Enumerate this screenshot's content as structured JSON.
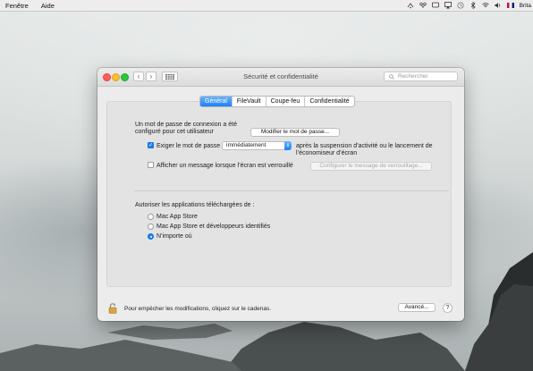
{
  "menubar": {
    "items": [
      "Fenêtre",
      "Aide"
    ],
    "user": "Brita"
  },
  "window": {
    "title": "Sécurité et confidentialité",
    "search_placeholder": "Rechercher",
    "back_glyph": "‹",
    "forward_glyph": "›"
  },
  "tabs": [
    {
      "label": "Général",
      "active": true
    },
    {
      "label": "FileVault",
      "active": false
    },
    {
      "label": "Coupe-feu",
      "active": false
    },
    {
      "label": "Confidentialité",
      "active": false
    }
  ],
  "general": {
    "password_text_line1": "Un mot de passe de connexion a été",
    "password_text_line2": "configuré pour cet utilisateur",
    "change_password_button": "Modifier le mot de passe...",
    "require_password": {
      "checked": true,
      "label": "Exiger le mot de passe",
      "popup_value": "immédiatement",
      "after_line1": "après la suspension d’activité ou le lancement de",
      "after_line2": "l’économiseur d’écran"
    },
    "show_message": {
      "checked": false,
      "label": "Afficher un message lorsque l’écran est verrouillé",
      "button": "Configurer le message de verrouillage..."
    },
    "downloads_heading": "Autoriser les applications téléchargées de :",
    "download_options": [
      {
        "label": "Mac App Store",
        "selected": false
      },
      {
        "label": "Mac App Store et développeurs identifiés",
        "selected": false
      },
      {
        "label": "N’importe où",
        "selected": true
      }
    ]
  },
  "footer": {
    "lock_text": "Pour empêcher les modifications, cliquez sur le cadenas.",
    "advanced_button": "Avancé...",
    "help_glyph": "?"
  },
  "colors": {
    "accent": "#1a82fb",
    "close": "#fd5f57",
    "minimize": "#febc2e",
    "zoom": "#28c840"
  }
}
